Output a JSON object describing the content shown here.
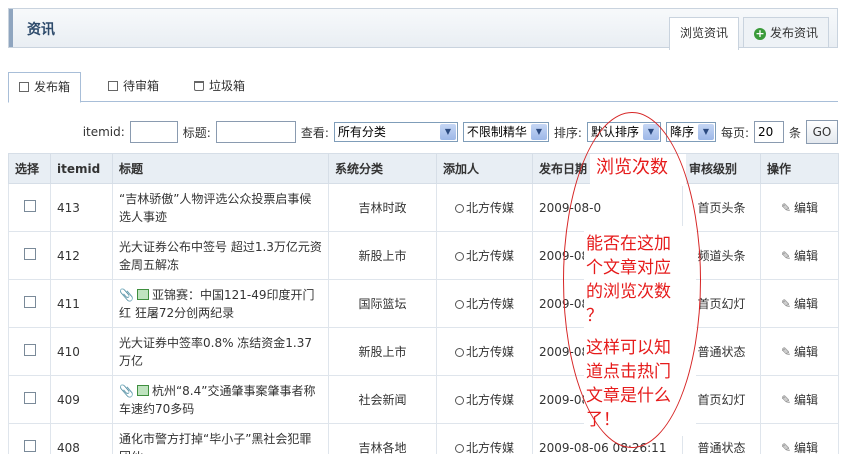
{
  "header": {
    "title": "资讯"
  },
  "top_tabs": [
    {
      "label": "浏览资讯",
      "active": true
    },
    {
      "label": "发布资讯",
      "active": false,
      "icon": "plus-icon"
    }
  ],
  "sub_tabs": [
    {
      "label": "发布箱",
      "active": true,
      "icon": "inbox-icon"
    },
    {
      "label": "待审箱",
      "active": false,
      "icon": "pending-icon"
    },
    {
      "label": "垃圾箱",
      "active": false,
      "icon": "trash-icon"
    }
  ],
  "filters": {
    "itemid_label": "itemid:",
    "title_label": "标题:",
    "view_label": "查看:",
    "category_value": "所有分类",
    "elite_value": "不限制精华",
    "sort_label": "排序:",
    "sort_value": "默认排序",
    "order_value": "降序",
    "perpage_label": "每页:",
    "perpage_value": "20",
    "perpage_unit": "条",
    "go_label": "GO"
  },
  "table": {
    "headers": [
      "选择",
      "itemid",
      "标题",
      "系统分类",
      "添加人",
      "发布日期",
      "审核级别",
      "操作"
    ],
    "rows": [
      {
        "itemid": "413",
        "title": "“吉林骄傲”人物评选公众投票启事候选人事迹",
        "category": "吉林时政",
        "author": "北方传媒",
        "date": "2009-08-0",
        "level": "首页头条",
        "action": "编辑",
        "clip": false,
        "img": false
      },
      {
        "itemid": "412",
        "title": "光大证券公布中签号 超过1.3万亿元资金周五解冻",
        "category": "新股上市",
        "author": "北方传媒",
        "date": "2009-08",
        "level": "频道头条",
        "action": "编辑",
        "clip": false,
        "img": false
      },
      {
        "itemid": "411",
        "title": "亚锦赛：中国121-49印度开门红 狂屠72分创两纪录",
        "category": "国际篮坛",
        "author": "北方传媒",
        "date": "2009-08",
        "level": "首页幻灯",
        "action": "编辑",
        "clip": true,
        "img": true
      },
      {
        "itemid": "410",
        "title": "光大证券中签率0.8% 冻结资金1.37万亿",
        "category": "新股上市",
        "author": "北方传媒",
        "date": "2009-08",
        "level": "普通状态",
        "action": "编辑",
        "clip": false,
        "img": false
      },
      {
        "itemid": "409",
        "title": "杭州“8.4”交通肇事案肇事者称车速约70多码",
        "category": "社会新闻",
        "author": "北方传媒",
        "date": "2009-08",
        "level": "首页幻灯",
        "action": "编辑",
        "clip": true,
        "img": true
      },
      {
        "itemid": "408",
        "title": "通化市警方打掉“毕小子”黑社会犯罪团伙",
        "category": "吉林各地",
        "author": "北方传媒",
        "date": "2009-08-06 08:26:11",
        "level": "普通状态",
        "action": "编辑",
        "clip": false,
        "img": false
      }
    ]
  },
  "annotation": {
    "header_text": "浏览次数",
    "lines_1": [
      "能否在这加",
      "个文章对应",
      "的浏览次数",
      "？"
    ],
    "lines_2": [
      "这样可以知",
      "道点击热门",
      "文章是什么",
      "了！"
    ]
  }
}
